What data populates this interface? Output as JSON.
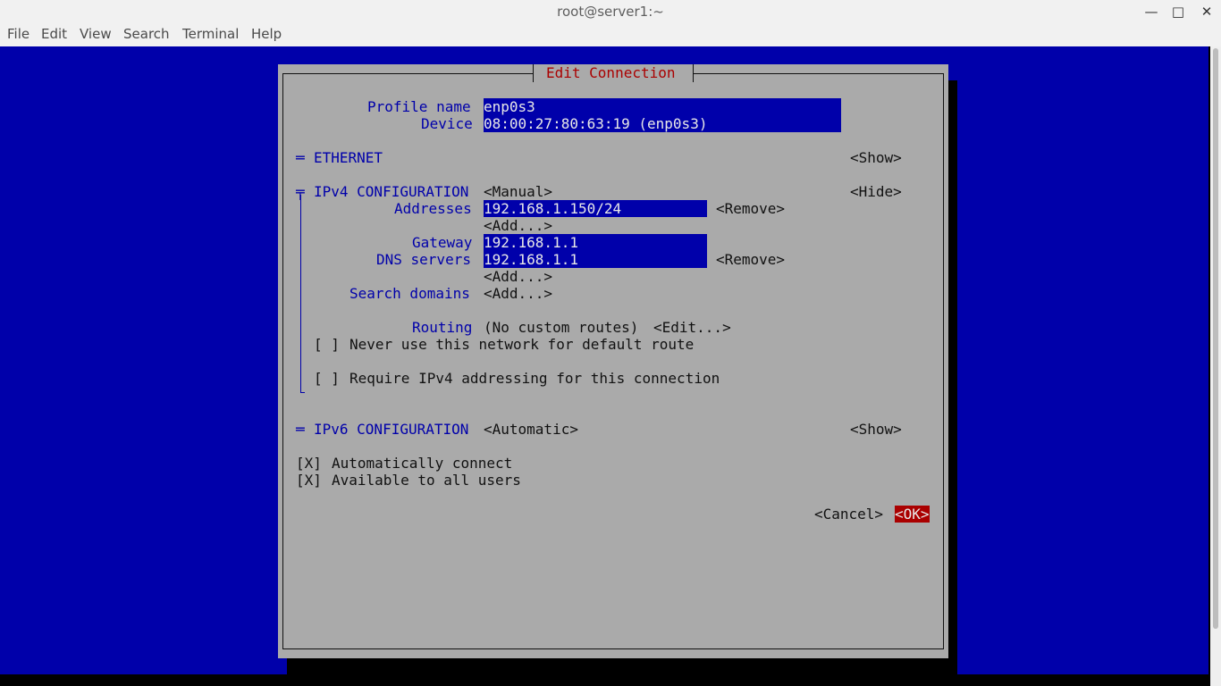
{
  "window": {
    "title": "root@server1:~",
    "minimize_glyph": "—",
    "maximize_glyph": "□",
    "close_glyph": "✕"
  },
  "menu": [
    "File",
    "Edit",
    "View",
    "Search",
    "Terminal",
    "Help"
  ],
  "dialog": {
    "title": "Edit Connection",
    "profile_name_label": "Profile name",
    "profile_name_value": "enp0s3",
    "device_label": "Device",
    "device_value": "08:00:27:80:63:19 (enp0s3)",
    "ethernet": {
      "marker": "═",
      "label": "ETHERNET",
      "toggle": "<Show>"
    },
    "ipv4": {
      "marker": "╤",
      "label": "IPv4 CONFIGURATION",
      "mode": "<Manual>",
      "toggle": "<Hide>",
      "addresses_label": "Addresses",
      "address_value": "192.168.1.150/24",
      "remove": "<Remove>",
      "add": "<Add...>",
      "gateway_label": "Gateway",
      "gateway_value": "192.168.1.1",
      "dns_label": "DNS servers",
      "dns_value": "192.168.1.1",
      "search_domains_label": "Search domains",
      "routing_label": "Routing",
      "routing_value": "(No custom routes)",
      "routing_edit": "<Edit...>",
      "never_default_check": "[ ]",
      "never_default_label": "Never use this network for default route",
      "require_ipv4_check": "[ ]",
      "require_ipv4_label": "Require IPv4 addressing for this connection"
    },
    "ipv6": {
      "marker": "═",
      "label": "IPv6 CONFIGURATION",
      "mode": "<Automatic>",
      "toggle": "<Show>"
    },
    "auto_connect_check": "[X]",
    "auto_connect_label": "Automatically connect",
    "all_users_check": "[X]",
    "all_users_label": "Available to all users",
    "cancel": "<Cancel>",
    "ok": "<OK>"
  },
  "colors": {
    "terminal_blue": "#0000aa",
    "dialog_gray": "#aaaaaa",
    "accent_red": "#aa0000"
  }
}
